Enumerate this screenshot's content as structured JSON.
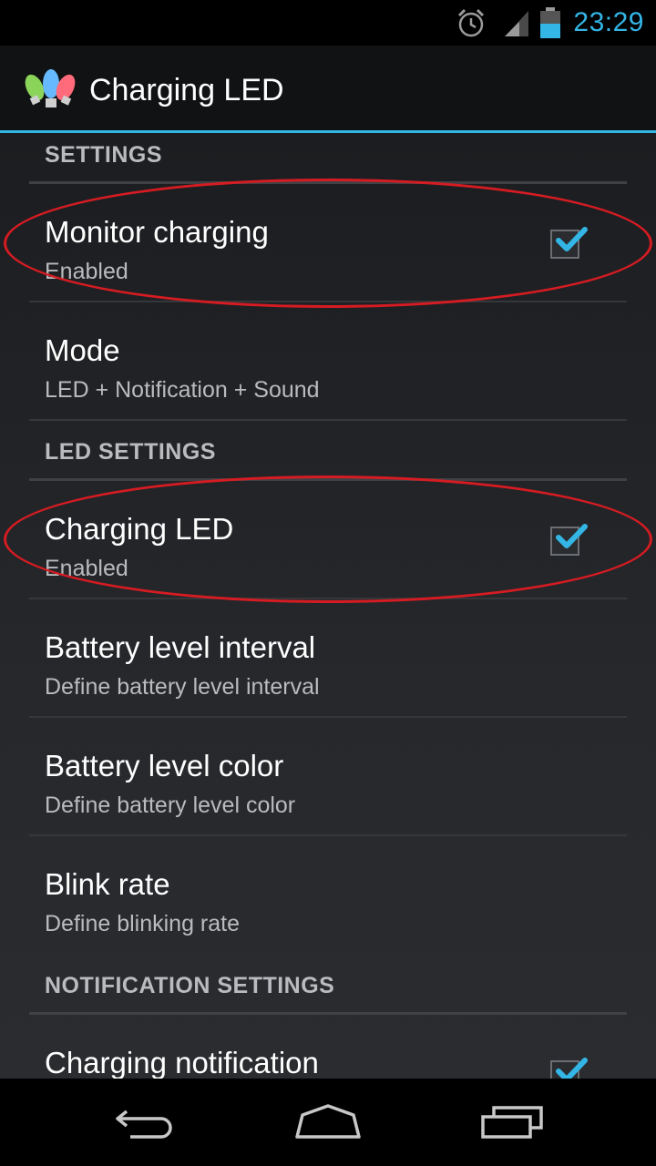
{
  "status_bar": {
    "time": "23:29",
    "icons": [
      "alarm-icon",
      "signal-icon",
      "battery-icon"
    ],
    "accent_color": "#33b5e5"
  },
  "action_bar": {
    "app_icon": "led-lights-icon",
    "title": "Charging LED"
  },
  "sections": [
    {
      "header": "SETTINGS"
    },
    {
      "header": "LED SETTINGS"
    },
    {
      "header": "NOTIFICATION SETTINGS"
    }
  ],
  "preferences": {
    "monitor_charging": {
      "title": "Monitor charging",
      "summary": "Enabled",
      "checked": true
    },
    "mode": {
      "title": "Mode",
      "summary": "LED + Notification + Sound"
    },
    "charging_led": {
      "title": "Charging LED",
      "summary": "Enabled",
      "checked": true
    },
    "battery_level_interval": {
      "title": "Battery level interval",
      "summary": "Define battery level interval"
    },
    "battery_level_color": {
      "title": "Battery level color",
      "summary": "Define battery level color"
    },
    "blink_rate": {
      "title": "Blink rate",
      "summary": "Define blinking rate"
    },
    "charging_notification": {
      "title": "Charging notification",
      "checked": true
    }
  },
  "annotation_color": "#d61c22",
  "nav_bar": {
    "buttons": [
      "back-icon",
      "home-icon",
      "recent-apps-icon"
    ]
  }
}
